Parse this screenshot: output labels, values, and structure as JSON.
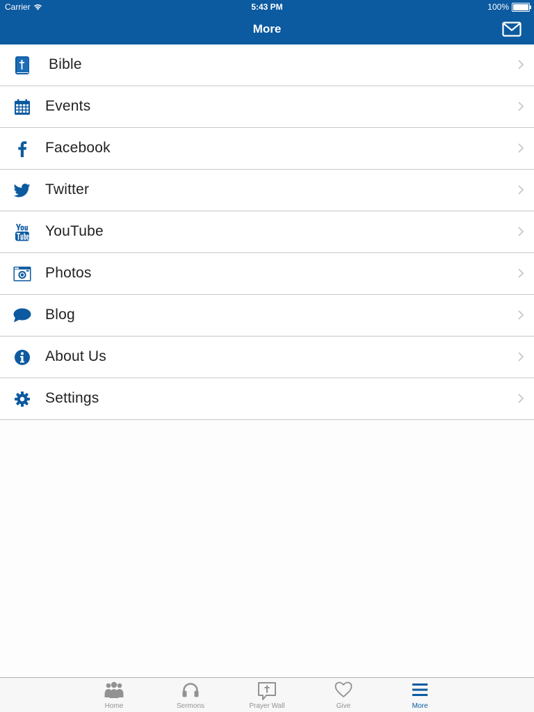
{
  "status_bar": {
    "carrier": "Carrier",
    "time": "5:43 PM",
    "battery": "100%"
  },
  "nav": {
    "title": "More"
  },
  "menu": [
    {
      "label": "Bible",
      "icon": "bible-icon"
    },
    {
      "label": "Events",
      "icon": "calendar-icon"
    },
    {
      "label": "Facebook",
      "icon": "facebook-icon"
    },
    {
      "label": "Twitter",
      "icon": "twitter-icon"
    },
    {
      "label": "YouTube",
      "icon": "youtube-icon"
    },
    {
      "label": "Photos",
      "icon": "camera-icon"
    },
    {
      "label": "Blog",
      "icon": "speech-bubble-icon"
    },
    {
      "label": "About Us",
      "icon": "info-icon"
    },
    {
      "label": "Settings",
      "icon": "gear-icon"
    }
  ],
  "tabs": [
    {
      "label": "Home",
      "icon": "people-icon"
    },
    {
      "label": "Sermons",
      "icon": "headphones-icon"
    },
    {
      "label": "Prayer Wall",
      "icon": "prayer-bubble-icon"
    },
    {
      "label": "Give",
      "icon": "heart-icon"
    },
    {
      "label": "More",
      "icon": "hamburger-icon",
      "active": true
    }
  ],
  "colors": {
    "brand": "#0c5aa0",
    "tab_inactive": "#929292",
    "separator": "#c8c7cc"
  }
}
